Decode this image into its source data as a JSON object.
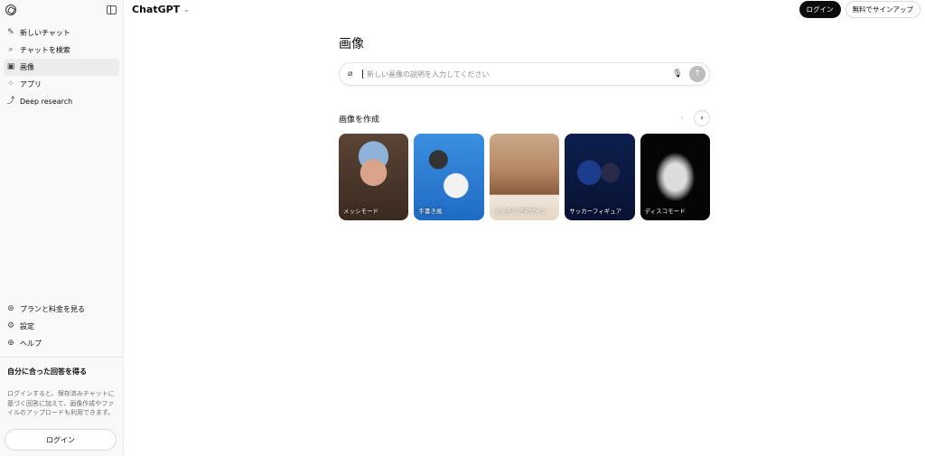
{
  "sidebar": {
    "nav": [
      {
        "label": "新しいチャット",
        "icon": "edit-icon"
      },
      {
        "label": "チャットを検索",
        "icon": "search-icon"
      },
      {
        "label": "画像",
        "icon": "images-icon"
      },
      {
        "label": "アプリ",
        "icon": "apps-icon"
      },
      {
        "label": "Deep research",
        "icon": "telescope-icon"
      }
    ],
    "bottom": [
      {
        "label": "プランと料金を見る",
        "icon": "plan-icon"
      },
      {
        "label": "設定",
        "icon": "gear-icon"
      },
      {
        "label": "ヘルプ",
        "icon": "help-icon"
      }
    ],
    "promo_title": "自分に合った回答を得る",
    "promo_text": "ログインすると、保存済みチャットに基づく回答に加えて、画像作成やファイルのアップロードも利用できます。",
    "login_label": "ログイン"
  },
  "header": {
    "model_name": "ChatGPT",
    "login_label": "ログイン",
    "signup_label": "無料でサインアップ"
  },
  "main": {
    "title": "画像",
    "prompt_placeholder": "新しい画像の説明を入力してください",
    "section_title": "画像を作成",
    "cards": [
      {
        "label": "メッシモード"
      },
      {
        "label": "手書き風"
      },
      {
        "label": "インテリアデザイン"
      },
      {
        "label": "サッカーフィギュア"
      },
      {
        "label": "ディスコモード"
      }
    ]
  }
}
